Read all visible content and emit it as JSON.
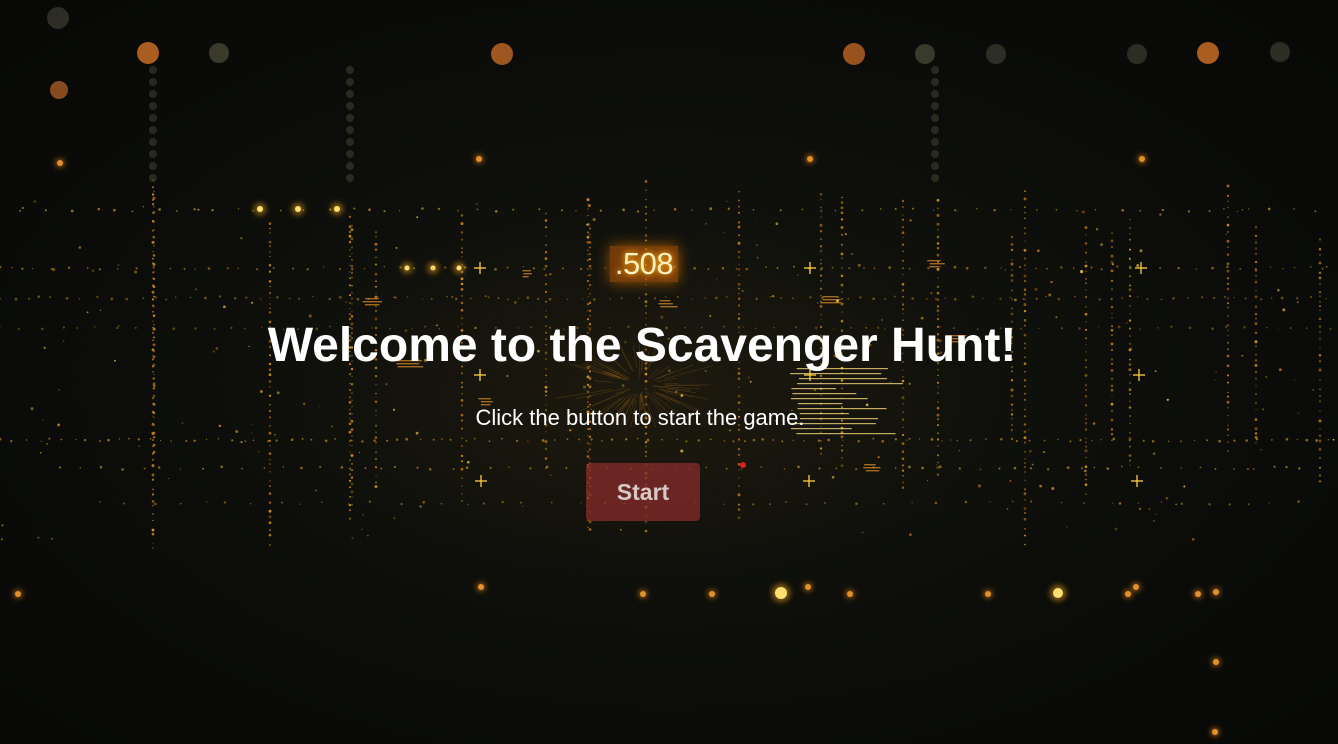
{
  "counter": {
    "value": ".508"
  },
  "welcome": {
    "title": "Welcome to the Scavenger Hunt!",
    "subtitle": "Click the button to start the game.",
    "start_label": "Start"
  },
  "colors": {
    "background": "#0b0c0a",
    "glow_orange": "#ff9a1a",
    "glow_yellow": "#ffd23a",
    "button": "#8c2d2d",
    "text": "#ffffff"
  }
}
